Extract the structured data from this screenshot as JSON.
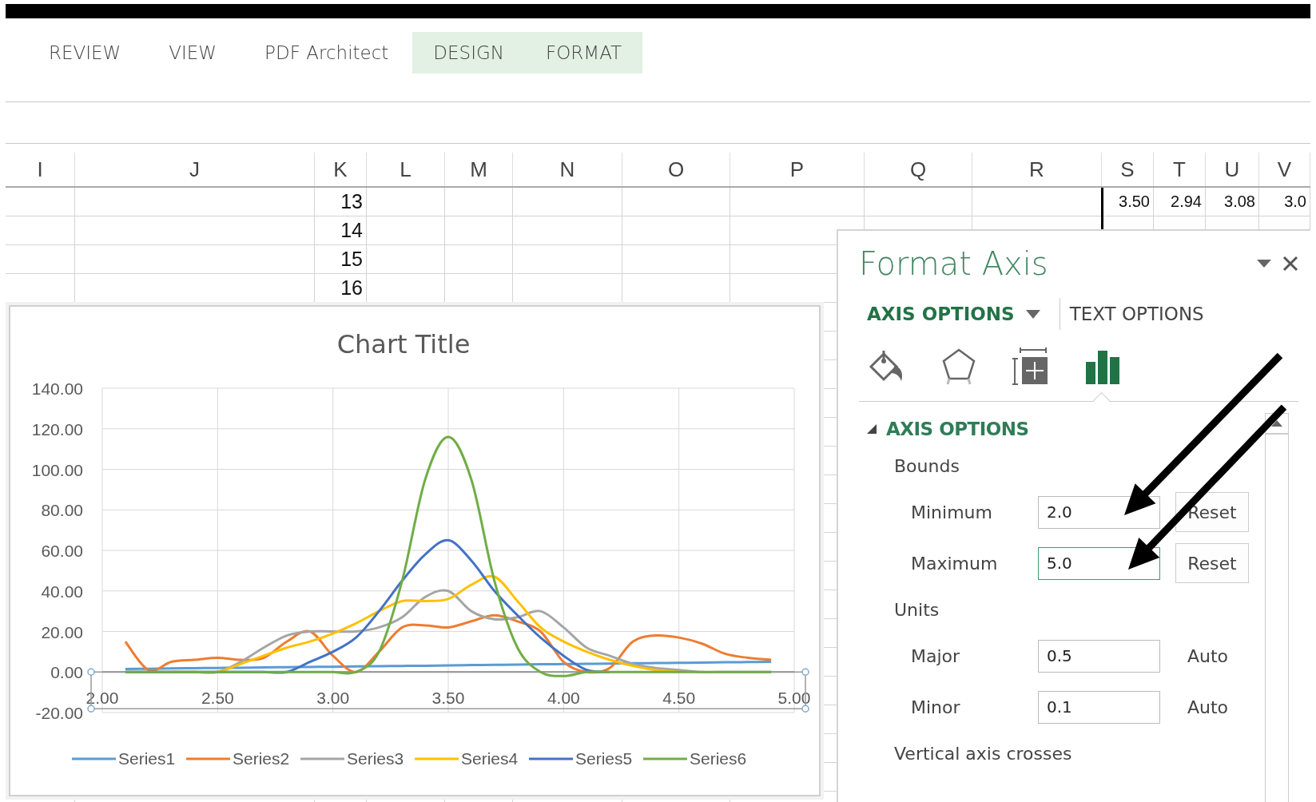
{
  "ribbon": {
    "tabs": [
      {
        "label": "REVIEW",
        "contextual": false
      },
      {
        "label": "VIEW",
        "contextual": false
      },
      {
        "label": "PDF Architect",
        "contextual": false
      },
      {
        "label": "DESIGN",
        "contextual": true
      },
      {
        "label": "FORMAT",
        "contextual": true
      }
    ]
  },
  "sheet": {
    "columns": [
      "I",
      "J",
      "K",
      "L",
      "M",
      "N",
      "O",
      "P",
      "Q",
      "R",
      "S",
      "T",
      "U",
      "V"
    ],
    "rows": [
      {
        "K": "13",
        "S": "3.50",
        "T": "2.94",
        "U": "3.08",
        "V": "3.0"
      },
      {
        "K": "14"
      },
      {
        "K": "15"
      },
      {
        "K": "16"
      }
    ]
  },
  "chart": {
    "chart_data": {
      "type": "line",
      "title": "Chart Title",
      "grid": true,
      "legend": "bottom",
      "xlim": [
        2,
        5
      ],
      "ylim": [
        -20,
        140
      ],
      "x": [
        2.1,
        2.2,
        2.3,
        2.4,
        2.5,
        2.6,
        2.7,
        2.8,
        2.9,
        3.0,
        3.1,
        3.2,
        3.3,
        3.4,
        3.5,
        3.6,
        3.7,
        3.8,
        3.9,
        4.0,
        4.1,
        4.2,
        4.3,
        4.4,
        4.5,
        4.6,
        4.7,
        4.8,
        4.9
      ],
      "xticks": [
        {
          "value": 2,
          "label": "2.00"
        },
        {
          "value": 2.5,
          "label": "2.50"
        },
        {
          "value": 3,
          "label": "3.00"
        },
        {
          "value": 3.5,
          "label": "3.50"
        },
        {
          "value": 4,
          "label": "4.00"
        },
        {
          "value": 4.5,
          "label": "4.50"
        },
        {
          "value": 5,
          "label": "5.00"
        }
      ],
      "yticks": [
        {
          "value": -20,
          "label": "-20.00"
        },
        {
          "value": 0,
          "label": "0.00"
        },
        {
          "value": 20,
          "label": "20.00"
        },
        {
          "value": 40,
          "label": "40.00"
        },
        {
          "value": 60,
          "label": "60.00"
        },
        {
          "value": 80,
          "label": "80.00"
        },
        {
          "value": 100,
          "label": "100.00"
        },
        {
          "value": 120,
          "label": "120.00"
        },
        {
          "value": 140,
          "label": "140.00"
        }
      ],
      "series": [
        {
          "name": "Series1",
          "color": "#5b9bd5",
          "values": [
            1.5,
            1.6,
            1.8,
            1.9,
            2.0,
            2.1,
            2.3,
            2.4,
            2.5,
            2.6,
            2.8,
            2.9,
            3.0,
            3.1,
            3.3,
            3.4,
            3.5,
            3.6,
            3.8,
            3.9,
            4.0,
            4.1,
            4.3,
            4.4,
            4.5,
            4.6,
            4.8,
            4.9,
            5.0
          ]
        },
        {
          "name": "Series2",
          "color": "#ed7d31",
          "values": [
            15,
            1,
            5,
            6,
            7,
            6,
            7,
            15,
            20,
            8,
            0,
            10,
            22,
            23,
            22,
            25,
            28,
            25,
            20,
            5,
            0,
            2,
            15,
            18,
            17,
            14,
            9,
            7,
            6
          ]
        },
        {
          "name": "Series3",
          "color": "#a5a5a5",
          "values": [
            0,
            0,
            0,
            0,
            0,
            5,
            12,
            18,
            20,
            20,
            20,
            22,
            27,
            37,
            40,
            30,
            26,
            27,
            30,
            22,
            12,
            8,
            4,
            2,
            1,
            0,
            0,
            0,
            0
          ]
        },
        {
          "name": "Series4",
          "color": "#ffc000",
          "values": [
            null,
            null,
            0,
            0,
            0,
            4,
            8,
            12,
            15,
            19,
            24,
            30,
            35,
            35,
            36,
            43,
            47,
            35,
            22,
            15,
            10,
            6,
            3,
            1,
            0,
            null,
            null,
            null,
            null
          ]
        },
        {
          "name": "Series5",
          "color": "#4472c4",
          "values": [
            0,
            0,
            0,
            0,
            0,
            0,
            0,
            0,
            5,
            10,
            17,
            30,
            45,
            58,
            65,
            55,
            40,
            28,
            17,
            8,
            1,
            0,
            null,
            null,
            null,
            null,
            null,
            null,
            null
          ]
        },
        {
          "name": "Series6",
          "color": "#70ad47",
          "values": [
            0,
            0,
            0,
            0,
            0,
            0,
            0,
            0,
            0,
            0,
            0,
            10,
            45,
            95,
            116,
            95,
            45,
            12,
            0,
            -2,
            0,
            0,
            0,
            0,
            0,
            0,
            0,
            0,
            0
          ]
        }
      ]
    }
  },
  "format_pane": {
    "title": "Format Axis",
    "tabs": [
      {
        "label": "AXIS OPTIONS",
        "selected": true
      },
      {
        "label": "TEXT OPTIONS",
        "selected": false
      }
    ],
    "icon_tabs": [
      {
        "kind": "fill",
        "selected": false
      },
      {
        "kind": "effects",
        "selected": false
      },
      {
        "kind": "size",
        "selected": false
      },
      {
        "kind": "axis",
        "selected": true
      }
    ],
    "section": {
      "title": "AXIS OPTIONS",
      "expanded": true,
      "groups": [
        {
          "heading": "Bounds",
          "fields": [
            {
              "label": "Minimum",
              "value": "2.0",
              "focused": false,
              "action": {
                "kind": "button",
                "label": "Reset"
              }
            },
            {
              "label": "Maximum",
              "value": "5.0",
              "focused": true,
              "action": {
                "kind": "button",
                "label": "Reset"
              }
            }
          ]
        },
        {
          "heading": "Units",
          "fields": [
            {
              "label": "Major",
              "value": "0.5",
              "focused": false,
              "action": {
                "kind": "text",
                "label": "Auto"
              }
            },
            {
              "label": "Minor",
              "value": "0.1",
              "focused": false,
              "action": {
                "kind": "text",
                "label": "Auto"
              }
            }
          ]
        },
        {
          "heading": "Vertical axis crosses"
        }
      ]
    }
  },
  "overlay_arrows": [
    {
      "kind": "arrow"
    },
    {
      "kind": "arrow"
    }
  ]
}
